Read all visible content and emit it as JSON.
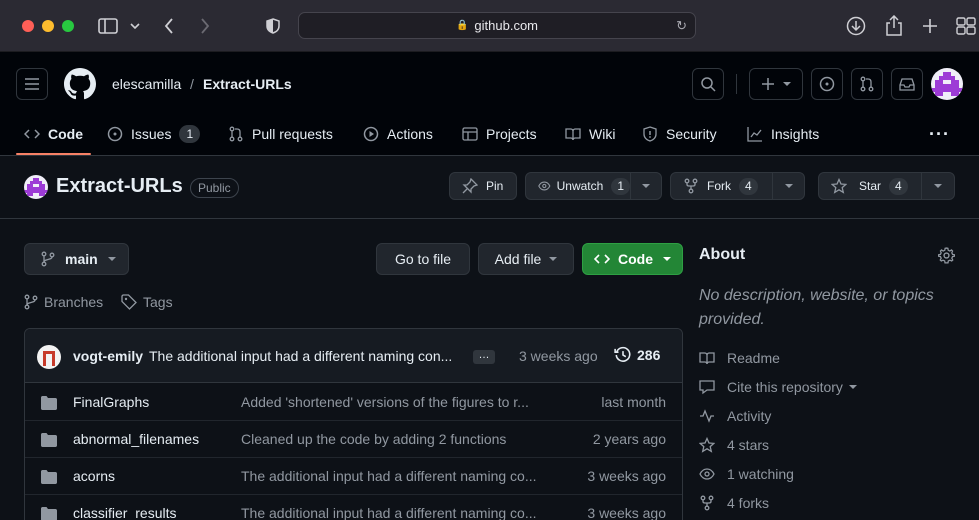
{
  "browser": {
    "url": "github.com"
  },
  "header": {
    "owner": "elescamilla",
    "separator": "/",
    "repo": "Extract-URLs",
    "tabs": [
      {
        "label": "Code"
      },
      {
        "label": "Issues",
        "count": "1"
      },
      {
        "label": "Pull requests"
      },
      {
        "label": "Actions"
      },
      {
        "label": "Projects"
      },
      {
        "label": "Wiki"
      },
      {
        "label": "Security"
      },
      {
        "label": "Insights"
      }
    ],
    "more": "···"
  },
  "repo": {
    "name": "Extract-URLs",
    "visibility": "Public",
    "pin_label": "Pin",
    "watch_label": "Unwatch",
    "watch_count": "1",
    "fork_label": "Fork",
    "fork_count": "4",
    "star_label": "Star",
    "star_count": "4"
  },
  "main": {
    "branch": "main",
    "go_to_file": "Go to file",
    "add_file": "Add file",
    "code_label": "Code",
    "branches_label": "Branches",
    "tags_label": "Tags",
    "commit": {
      "author": "vogt-emily",
      "message": "The additional input had a different naming con...",
      "ellipsis": "…",
      "time": "3 weeks ago",
      "count": "286"
    },
    "files": [
      {
        "name": "FinalGraphs",
        "message": "Added 'shortened' versions of the figures to r...",
        "time": "last month"
      },
      {
        "name": "abnormal_filenames",
        "message": "Cleaned up the code by adding 2 functions",
        "time": "2 years ago"
      },
      {
        "name": "acorns",
        "message": "The additional input had a different naming co...",
        "time": "3 weeks ago"
      },
      {
        "name": "classifier_results",
        "message": "The additional input had a different naming co...",
        "time": "3 weeks ago"
      }
    ]
  },
  "about": {
    "title": "About",
    "description": "No description, website, or topics provided.",
    "items": [
      {
        "label": "Readme"
      },
      {
        "label": "Cite this repository"
      },
      {
        "label": "Activity"
      },
      {
        "label": "4 stars"
      },
      {
        "label": "1 watching"
      },
      {
        "label": "4 forks"
      }
    ]
  },
  "colors": {
    "primary_button": "#238636",
    "tab_underline": "#f78166",
    "background": "#0d1117"
  }
}
